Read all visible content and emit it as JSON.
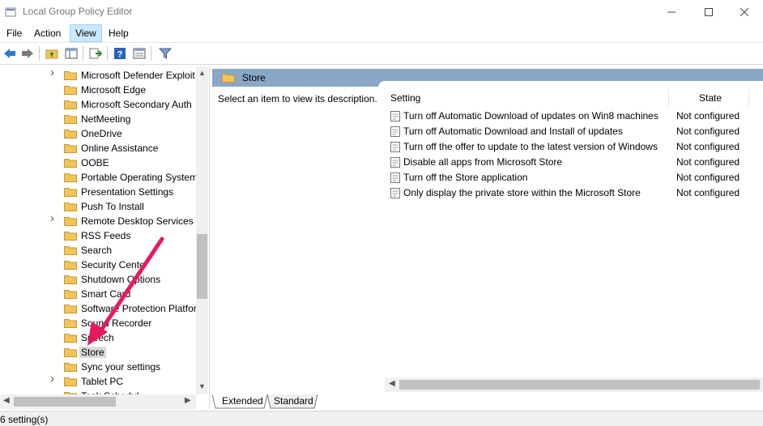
{
  "window": {
    "title": "Local Group Policy Editor"
  },
  "menu": [
    "File",
    "Action",
    "View",
    "Help"
  ],
  "tree": [
    {
      "label": "Microsoft Defender Exploit",
      "expandable": true
    },
    {
      "label": "Microsoft Edge",
      "expandable": false
    },
    {
      "label": "Microsoft Secondary Auth",
      "expandable": false
    },
    {
      "label": "NetMeeting",
      "expandable": false
    },
    {
      "label": "OneDrive",
      "expandable": false
    },
    {
      "label": "Online Assistance",
      "expandable": false
    },
    {
      "label": "OOBE",
      "expandable": false
    },
    {
      "label": "Portable Operating System",
      "expandable": false
    },
    {
      "label": "Presentation Settings",
      "expandable": false
    },
    {
      "label": "Push To Install",
      "expandable": false
    },
    {
      "label": "Remote Desktop Services",
      "expandable": true
    },
    {
      "label": "RSS Feeds",
      "expandable": false
    },
    {
      "label": "Search",
      "expandable": false
    },
    {
      "label": "Security Cente",
      "expandable": false
    },
    {
      "label": "Shutdown Options",
      "expandable": false
    },
    {
      "label": "Smart Card",
      "expandable": false
    },
    {
      "label": "Software Protection Platfor",
      "expandable": false
    },
    {
      "label": "Sound Recorder",
      "expandable": false
    },
    {
      "label": "Speech",
      "expandable": false
    },
    {
      "label": "Store",
      "expandable": false,
      "selected": true
    },
    {
      "label": "Sync your settings",
      "expandable": false
    },
    {
      "label": "Tablet PC",
      "expandable": true
    },
    {
      "label": "Task Schedul",
      "expandable": false
    }
  ],
  "details": {
    "header": "Store",
    "description": "Select an item to view its description.",
    "columns": {
      "setting": "Setting",
      "state": "State"
    },
    "rows": [
      {
        "name": "Turn off Automatic Download of updates on Win8 machines",
        "state": "Not configured"
      },
      {
        "name": "Turn off Automatic Download and Install of updates",
        "state": "Not configured"
      },
      {
        "name": "Turn off the offer to update to the latest version of Windows",
        "state": "Not configured"
      },
      {
        "name": "Disable all apps from Microsoft Store",
        "state": "Not configured"
      },
      {
        "name": "Turn off the Store application",
        "state": "Not configured"
      },
      {
        "name": "Only display the private store within the Microsoft Store",
        "state": "Not configured"
      }
    ]
  },
  "tabs": [
    "Extended",
    "Standard"
  ],
  "status": "6 setting(s)",
  "colors": {
    "accent": "#8aa7c6",
    "arrow": "#e6195f"
  }
}
